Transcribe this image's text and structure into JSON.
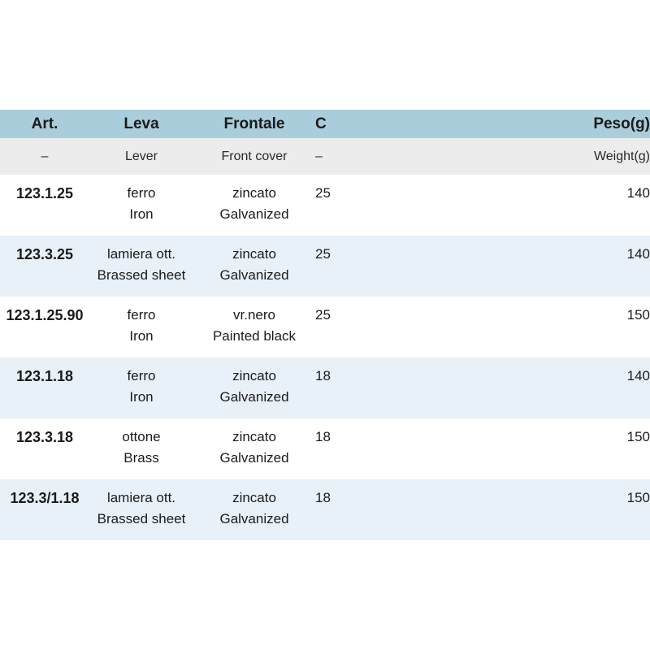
{
  "table": {
    "name": "product-specification-table",
    "columns": [
      {
        "key": "art",
        "header_it": "Art.",
        "header_en": "–",
        "align": "center"
      },
      {
        "key": "leva",
        "header_it": "Leva",
        "header_en": "Lever",
        "align": "center"
      },
      {
        "key": "frontale",
        "header_it": "Frontale",
        "header_en": "Front cover",
        "align": "center"
      },
      {
        "key": "c",
        "header_it": "C",
        "header_en": "–",
        "align": "left"
      },
      {
        "key": "peso",
        "header_it": "Peso(g)",
        "header_en": "Weight(g)",
        "align": "right"
      }
    ],
    "header": {
      "art": "Art.",
      "leva": "Leva",
      "frontale": "Frontale",
      "c": "C",
      "peso": "Peso(g)"
    },
    "subtitle": {
      "art": "–",
      "leva": "Lever",
      "frontale": "Front cover",
      "c": "–",
      "peso": "Weight(g)"
    },
    "rows": [
      {
        "art_it": "123.1.25",
        "art_en": "",
        "leva_it": "ferro",
        "leva_en": "Iron",
        "frontale_it": "zincato",
        "frontale_en": "Galvanized",
        "c": "25",
        "peso": "140"
      },
      {
        "art_it": "123.3.25",
        "art_en": "",
        "leva_it": "lamiera ott.",
        "leva_en": "Brassed sheet",
        "frontale_it": "zincato",
        "frontale_en": "Galvanized",
        "c": "25",
        "peso": "140"
      },
      {
        "art_it": "123.1.25.90",
        "art_en": "",
        "leva_it": "ferro",
        "leva_en": "Iron",
        "frontale_it": "vr.nero",
        "frontale_en": "Painted black",
        "c": "25",
        "peso": "150"
      },
      {
        "art_it": "123.1.18",
        "art_en": "",
        "leva_it": "ferro",
        "leva_en": "Iron",
        "frontale_it": "zincato",
        "frontale_en": "Galvanized",
        "c": "18",
        "peso": "140"
      },
      {
        "art_it": "123.3.18",
        "art_en": "",
        "leva_it": "ottone",
        "leva_en": "Brass",
        "frontale_it": "zincato",
        "frontale_en": "Galvanized",
        "c": "18",
        "peso": "150"
      },
      {
        "art_it": "123.3/1.18",
        "art_en": "",
        "leva_it": "lamiera ott.",
        "leva_en": "Brassed sheet",
        "frontale_it": "zincato",
        "frontale_en": "Galvanized",
        "c": "18",
        "peso": "150"
      }
    ]
  },
  "colors": {
    "header_band": "#a9cdda",
    "subtitle_band": "#ececec",
    "row_odd": "#ffffff",
    "row_even": "#e8f1f8",
    "text": "#1b1b1b",
    "page_background": "#ffffff"
  }
}
